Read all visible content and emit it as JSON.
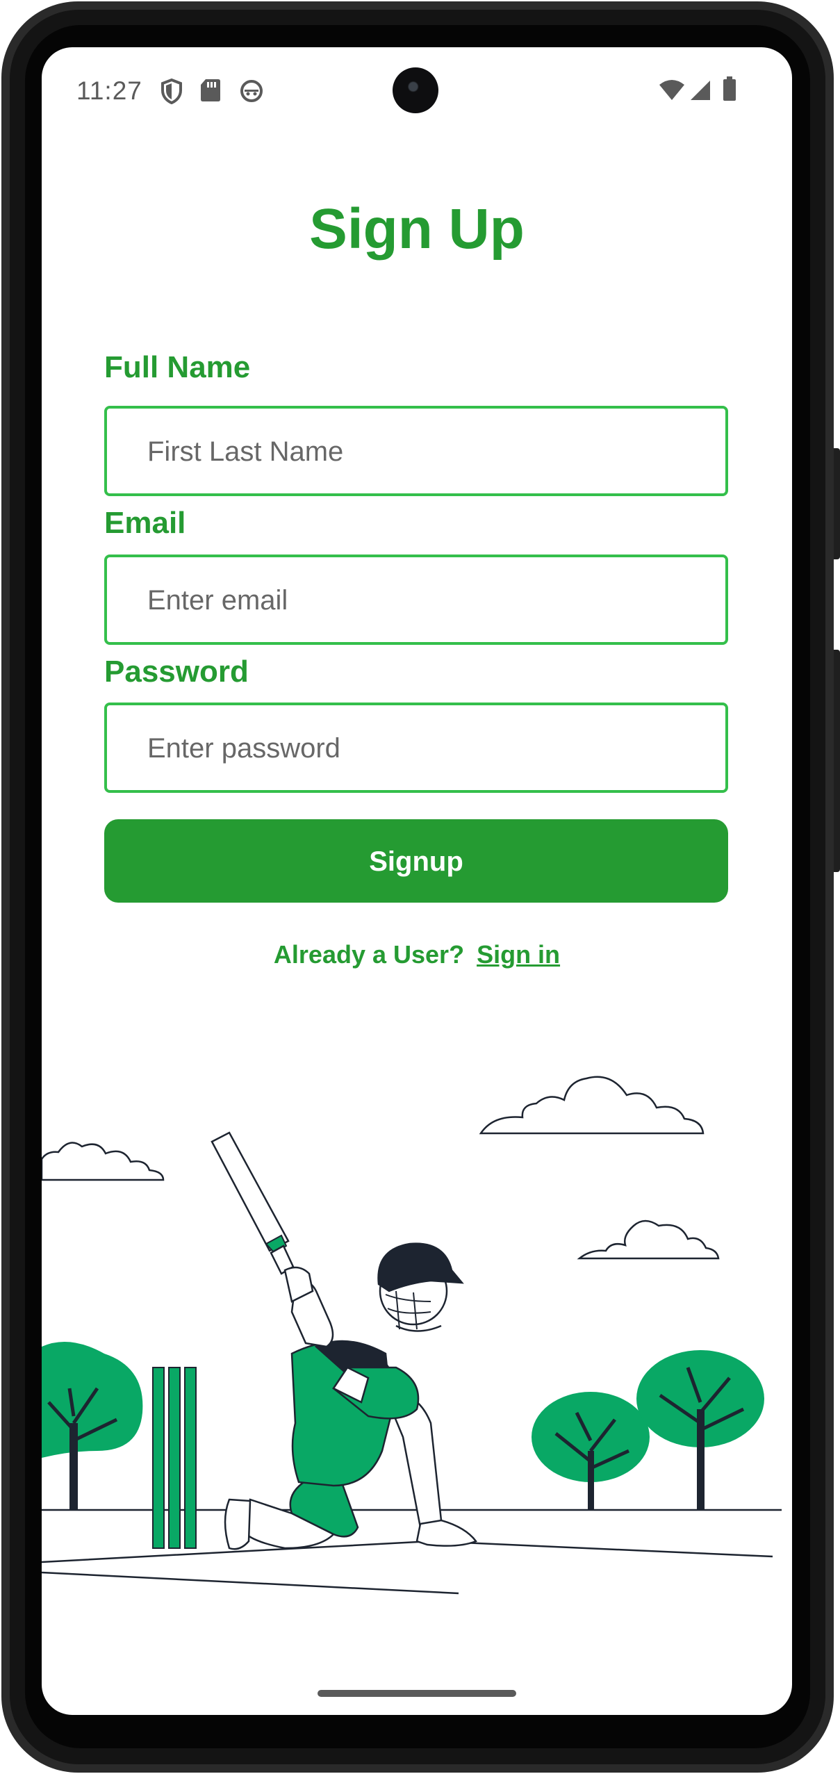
{
  "status_bar": {
    "time": "11:27",
    "left_icons": [
      "shield-icon",
      "sd-card-icon",
      "android-robot-icon"
    ],
    "right_icons": [
      "wifi-icon",
      "signal-icon",
      "battery-icon"
    ]
  },
  "page": {
    "title": "Sign Up"
  },
  "form": {
    "full_name": {
      "label": "Full Name",
      "placeholder": "First Last Name",
      "value": ""
    },
    "email": {
      "label": "Email",
      "placeholder": "Enter email",
      "value": ""
    },
    "password": {
      "label": "Password",
      "placeholder": "Enter password",
      "value": ""
    },
    "submit_label": "Signup"
  },
  "footer": {
    "prompt": "Already a User?",
    "link_label": "Sign in"
  },
  "colors": {
    "accent": "#259b32",
    "field_border": "#34bf4b",
    "illustration_green": "#09a865",
    "illustration_dark": "#1d2430"
  },
  "illustration": {
    "subject": "cricket-batsman-illustration"
  }
}
